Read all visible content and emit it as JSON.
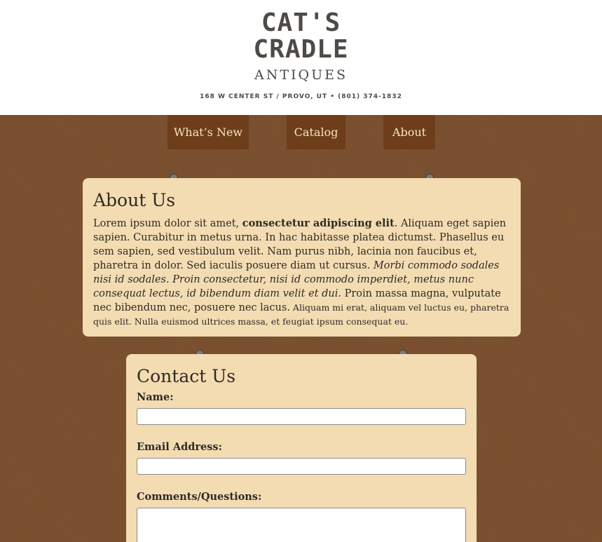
{
  "header": {
    "logo": {
      "line1": "CAT'S",
      "line2": "CRADLE",
      "line3": "ANTIQUES"
    },
    "address": "168 W CENTER ST / PROVO, UT  •  (801) 374-1832"
  },
  "nav": {
    "items": [
      {
        "label": "What’s New"
      },
      {
        "label": "Catalog"
      },
      {
        "label": "About"
      }
    ]
  },
  "about": {
    "title": "About Us",
    "p1": "Lorem ipsum dolor sit amet, ",
    "p1_bold": "consectetur adipiscing elit",
    "p2": ". Aliquam eget sapien sapien. Curabitur in metus urna. In hac habitasse platea dictumst. Phasellus eu sem sapien, sed vestibulum velit. Nam purus nibh, lacinia non faucibus et, pharetra in dolor. Sed iaculis posuere diam ut cursus. ",
    "p2_italic": "Morbi commodo sodales nisi id sodales. Proin consectetur, nisi id commodo imperdiet, metus nunc consequat lectus, id bibendum diam velit et dui.",
    "p3": " Proin massa magna, vulputate nec bibendum nec, posuere nec lacus.",
    "p3_small": " Aliquam mi erat, aliquam vel luctus eu, pharetra quis elit. Nulla euismod ultrices massa, et feugiat ipsum consequat eu."
  },
  "contact": {
    "title": "Contact Us",
    "name_label": "Name:",
    "name_value": "",
    "email_label": "Email Address:",
    "email_value": "",
    "comments_label": "Comments/Questions:",
    "comments_value": ""
  },
  "colors": {
    "page_background": "#7a4f2e",
    "header_background": "#ffffff",
    "nav_background": "#6e3e1a",
    "nav_text": "#f6e4c3",
    "card_background": "#f4dcb2",
    "logo_text": "#4e4a46"
  },
  "icons": {
    "pin": "pushpin-icon"
  }
}
